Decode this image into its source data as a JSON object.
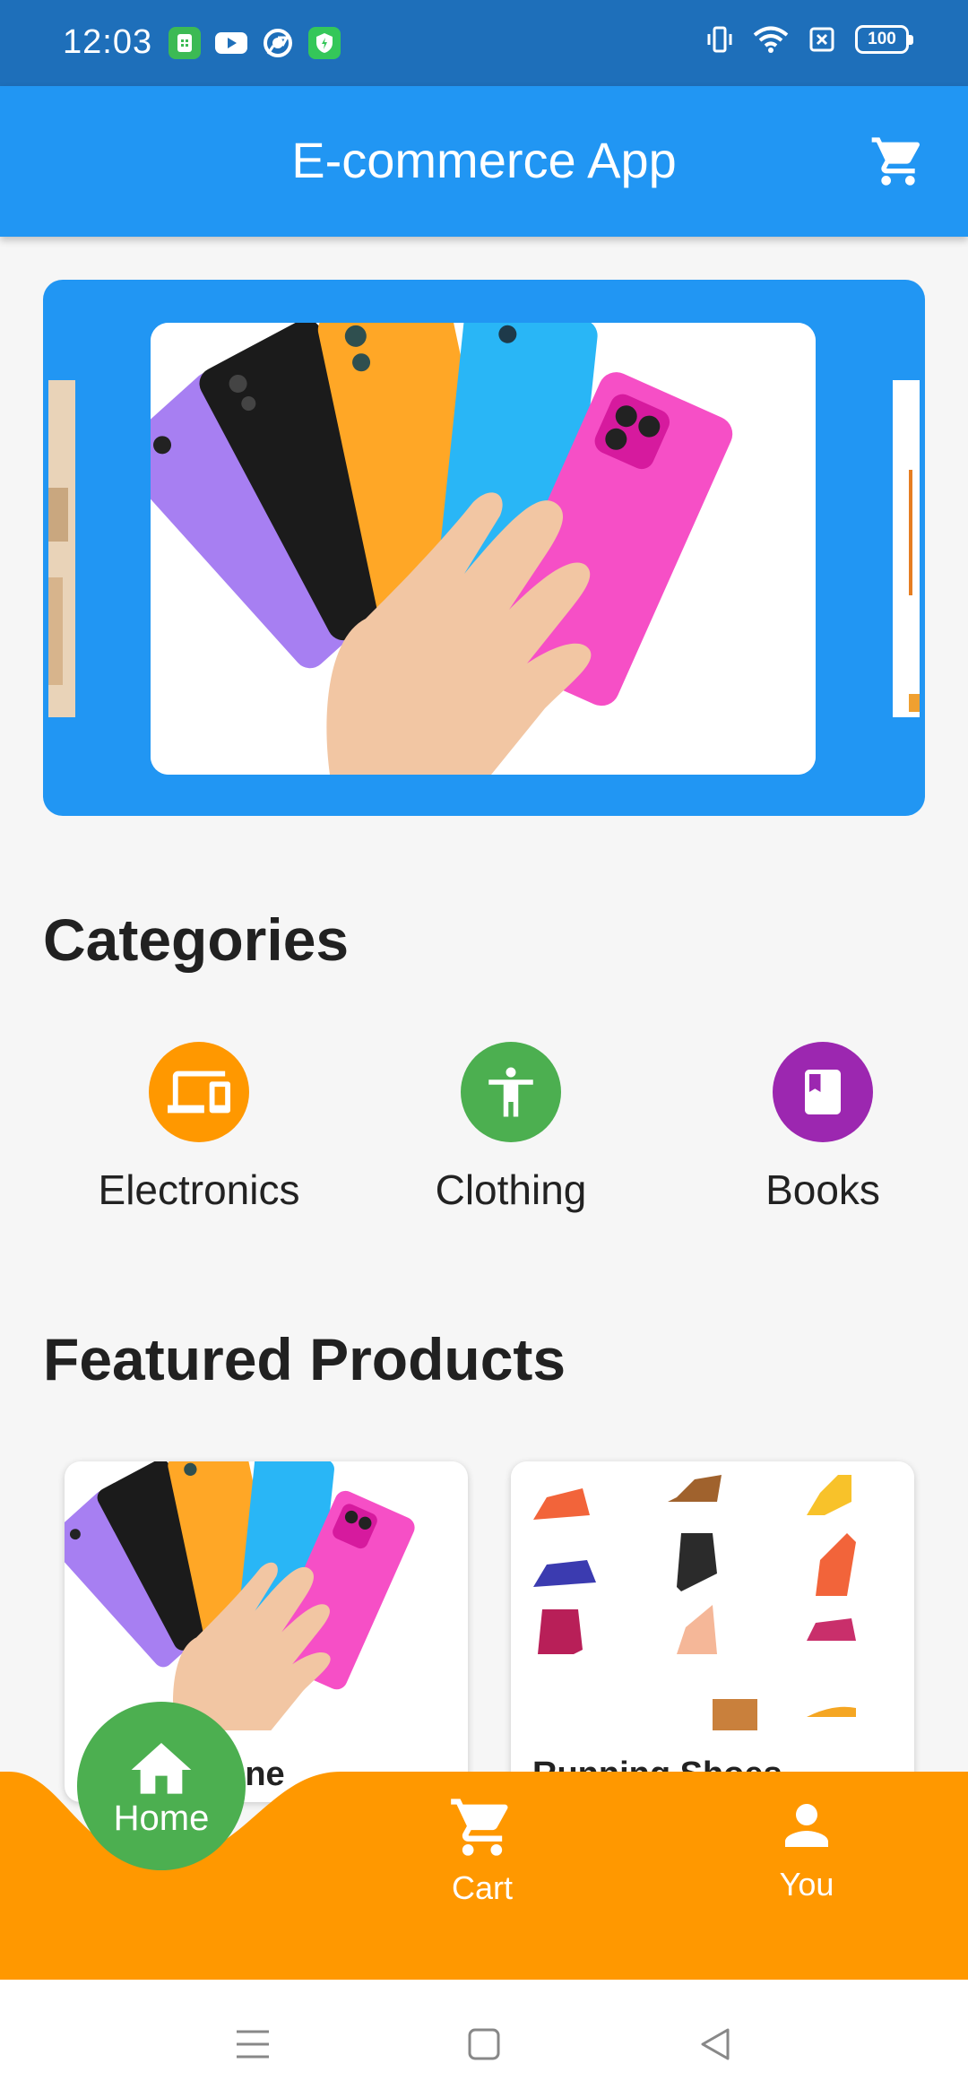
{
  "status_bar": {
    "time": "12:03",
    "notification_icons": [
      "app-notification-icon",
      "youtube-icon",
      "chrome-icon",
      "security-icon"
    ],
    "system_icons": [
      "vibrate-icon",
      "wifi-icon",
      "sim-icon",
      "battery-icon"
    ],
    "battery": "100"
  },
  "app_bar": {
    "title": "E-commerce App",
    "cart_icon": "shopping-cart-icon",
    "color": "#2196f3"
  },
  "carousel": {
    "slides": [
      "phones-banner"
    ],
    "color": "#2196f3"
  },
  "categories": {
    "title": "Categories",
    "items": [
      {
        "label": "Electronics",
        "icon": "devices-icon",
        "color": "#ff9800"
      },
      {
        "label": "Clothing",
        "icon": "accessibility-icon",
        "color": "#4caf50"
      },
      {
        "label": "Books",
        "icon": "book-icon",
        "color": "#9c27b0"
      }
    ]
  },
  "featured": {
    "title": "Featured Products",
    "products": [
      {
        "name": "Smartphone",
        "image": "phones-image"
      },
      {
        "name": "Running Shoes",
        "image": "shoes-image"
      }
    ]
  },
  "bottom_nav": {
    "color": "#ff9800",
    "active_color": "#4caf50",
    "items": [
      {
        "label": "Home",
        "icon": "home-icon"
      },
      {
        "label": "Cart",
        "icon": "cart-icon"
      },
      {
        "label": "You",
        "icon": "person-icon"
      }
    ]
  },
  "system_nav": {
    "buttons": [
      "menu-icon",
      "home-square-icon",
      "back-icon"
    ]
  }
}
